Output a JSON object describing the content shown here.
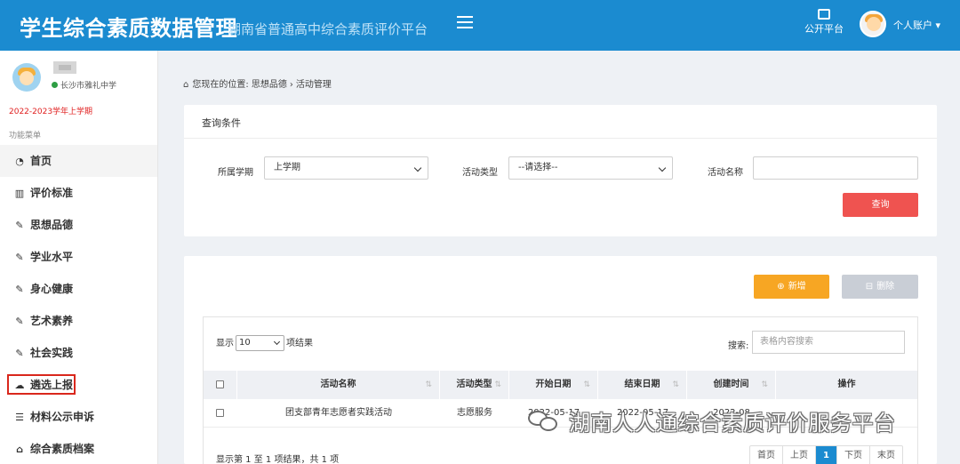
{
  "header": {
    "title": "学生综合素质数据管理",
    "subtitle": "湖南省普通高中综合素质评价平台",
    "public_platform": "公开平台",
    "account_label": "个人账户 ▾"
  },
  "sidebar": {
    "school": "长沙市雅礼中学",
    "semester": "2022-2023学年上学期",
    "menu_title": "功能菜单",
    "items": [
      {
        "label": "首页",
        "icon": "dashboard-icon"
      },
      {
        "label": "评价标准",
        "icon": "map-icon"
      },
      {
        "label": "思想品德",
        "icon": "edit-icon"
      },
      {
        "label": "学业水平",
        "icon": "edit-icon"
      },
      {
        "label": "身心健康",
        "icon": "edit-icon"
      },
      {
        "label": "艺术素养",
        "icon": "edit-icon"
      },
      {
        "label": "社会实践",
        "icon": "edit-icon"
      },
      {
        "label": "遴选上报",
        "icon": "cloud-upload-icon"
      },
      {
        "label": "材料公示申诉",
        "icon": "list-icon"
      },
      {
        "label": "综合素质档案",
        "icon": "graduation-cap-icon"
      }
    ]
  },
  "breadcrumb": {
    "prefix": "您现在的位置:",
    "parent": "思想品德",
    "current": "活动管理"
  },
  "query": {
    "title": "查询条件",
    "semester_label": "所属学期",
    "semester_value": "上学期",
    "type_label": "活动类型",
    "type_value": "--请选择--",
    "name_label": "活动名称",
    "name_value": "",
    "query_button": "查询"
  },
  "actions": {
    "add": "新增",
    "delete": "删除"
  },
  "table": {
    "length_prefix": "显示",
    "length_value": "10",
    "length_suffix": "项结果",
    "search_label": "搜索:",
    "search_placeholder": "表格内容搜索",
    "columns": [
      "活动名称",
      "活动类型",
      "开始日期",
      "结束日期",
      "创建时间",
      "操作"
    ],
    "rows": [
      [
        "团支部青年志愿者实践活动",
        "志愿服务",
        "2022-05-17",
        "2022-05-17",
        "2022-08",
        ""
      ]
    ],
    "info": "显示第 1 至 1 项结果，共 1 项",
    "pager": [
      "首页",
      "上页",
      "1",
      "下页",
      "末页"
    ]
  },
  "watermark": "湖南人人通综合素质评价服务平台",
  "colors": {
    "header_blue": "#1b8bd0",
    "query_red": "#ef5350",
    "add_orange": "#f7a623",
    "highlight_box": "#d9271c"
  }
}
